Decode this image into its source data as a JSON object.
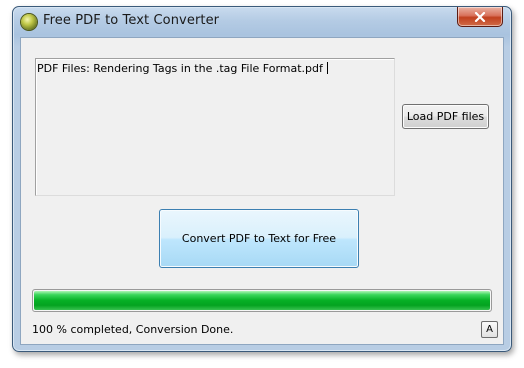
{
  "window": {
    "title": "Free PDF to Text Converter",
    "icon": "app-orb-icon",
    "close_icon": "close-x-icon"
  },
  "file_list": {
    "content": "PDF Files: Rendering Tags in the .tag File Format.pdf"
  },
  "buttons": {
    "load_label": "Load PDF files",
    "convert_label": "Convert PDF to Text for Free",
    "a_label": "A"
  },
  "progress": {
    "percent": 100,
    "color": "#06b025"
  },
  "status": {
    "text": "100 % completed, Conversion Done."
  }
}
